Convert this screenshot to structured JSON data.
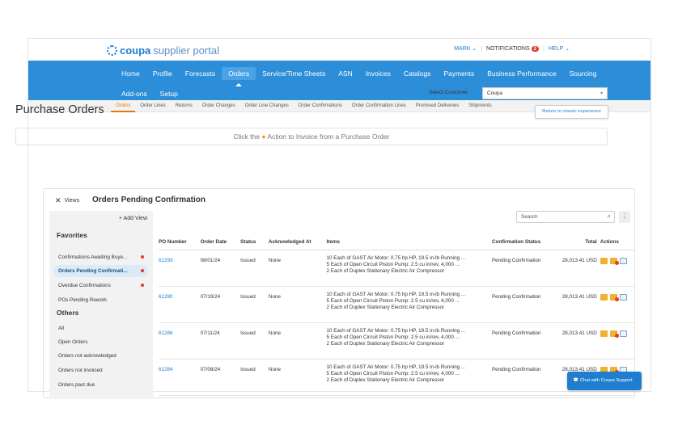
{
  "header": {
    "brand": "coupa",
    "brand_suffix": "supplier portal",
    "user": "MARK",
    "notifications_label": "NOTIFICATIONS",
    "notifications_count": "2",
    "help": "HELP"
  },
  "mainnav": {
    "row1": [
      "Home",
      "Profile",
      "Forecasts",
      "Orders",
      "Service/Time Sheets",
      "ASN",
      "Invoices",
      "Catalogs",
      "Payments",
      "Business Performance",
      "Sourcing"
    ],
    "row2": [
      "Add-ons",
      "Setup"
    ],
    "active": "Orders"
  },
  "subnav": [
    "Orders",
    "Order Lines",
    "Returns",
    "Order Changes",
    "Order Line Changes",
    "Order Confirmations",
    "Order Confirmation Lines",
    "Promised Deliveries",
    "Shipments"
  ],
  "customer": {
    "label": "Select Customer",
    "value": "Coupa"
  },
  "classic_button": "Return to classic experience",
  "page_title": "Purchase Orders",
  "banner": {
    "before": "Click the",
    "after": "Action to Invoice from a Purchase Order"
  },
  "views": {
    "close": "✕",
    "label": "Views",
    "title": "Orders Pending Confirmation",
    "add_view": "+ Add View"
  },
  "sidebar": {
    "favorites_label": "Favorites",
    "favorites": [
      {
        "label": "Confirmations Awaiting Buye...",
        "dot": true
      },
      {
        "label": "Orders Pending Confirmati...",
        "dot": true,
        "active": true
      },
      {
        "label": "Overdue Confirmations",
        "dot": true
      },
      {
        "label": "POs Pending Rework",
        "dot": false
      }
    ],
    "others_label": "Others",
    "others": [
      "All",
      "Open Orders",
      "Orders not acknowledged",
      "Orders not invoiced",
      "Orders past due"
    ]
  },
  "search": {
    "placeholder": "Search"
  },
  "table": {
    "columns": [
      "PO Number",
      "Order Date",
      "Status",
      "Acknowledged At",
      "Items",
      "Confirmation Status",
      "Total",
      "Actions"
    ],
    "rows": [
      {
        "po": "61293",
        "date": "08/01/24",
        "status": "Issued",
        "ack": "None",
        "items": [
          "10 Each of GAST Air Motor: 0.75 hp HP, 19.5 in-lb Running ...",
          "5 Each of Open Circuit Piston Pump: 2.5 cu in/rev, 4,000 ...",
          "2 Each of Duplex Stationary Electric Air Compressor"
        ],
        "conf": "Pending Confirmation",
        "total": "28,013.41 USD"
      },
      {
        "po": "61290",
        "date": "07/19/24",
        "status": "Issued",
        "ack": "None",
        "items": [
          "10 Each of GAST Air Motor: 0.75 hp HP, 19.5 in-lb Running ...",
          "5 Each of Open Circuit Piston Pump: 2.5 cu in/rev, 4,000 ...",
          "2 Each of Duplex Stationary Electric Air Compressor"
        ],
        "conf": "Pending Confirmation",
        "total": "28,013.41 USD"
      },
      {
        "po": "61286",
        "date": "07/11/24",
        "status": "Issued",
        "ack": "None",
        "items": [
          "10 Each of GAST Air Motor: 0.75 hp HP, 19.5 in-lb Running ...",
          "5 Each of Open Circuit Piston Pump: 2.5 cu in/rev, 4,000 ...",
          "2 Each of Duplex Stationary Electric Air Compressor"
        ],
        "conf": "Pending Confirmation",
        "total": "28,013.41 USD"
      },
      {
        "po": "61284",
        "date": "07/08/24",
        "status": "Issued",
        "ack": "None",
        "items": [
          "10 Each of GAST Air Motor: 0.75 hp HP, 19.5 in-lb Running ...",
          "5 Each of Open Circuit Piston Pump: 2.5 cu in/rev, 4,000 ...",
          "2 Each of Duplex Stationary Electric Air Compressor"
        ],
        "conf": "Pending Confirmation",
        "total": "28,013.41 USD"
      }
    ]
  },
  "chat": "Chat with Coupa Support",
  "colors": {
    "nav_blue": "#2c8dd8",
    "link_blue": "#1a7dd2",
    "accent_orange": "#e07a10",
    "alert_red": "#e03b2b"
  }
}
